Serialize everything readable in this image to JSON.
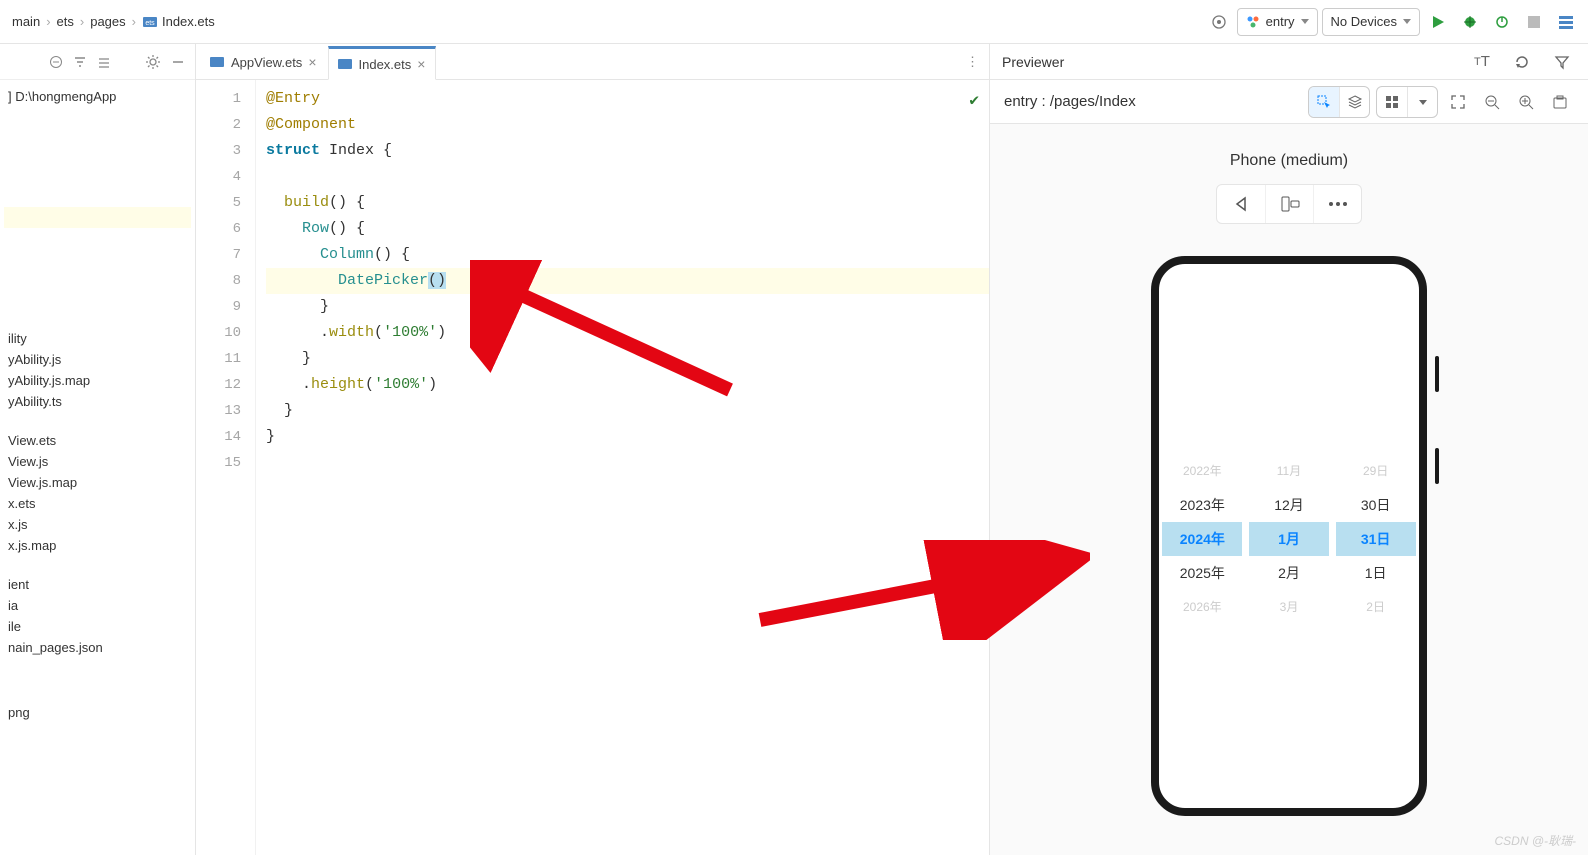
{
  "breadcrumb": [
    "main",
    "ets",
    "pages",
    "Index.ets"
  ],
  "toolbar": {
    "module": "entry",
    "device": "No Devices"
  },
  "tabs": [
    {
      "label": "AppView.ets",
      "active": false
    },
    {
      "label": "Index.ets",
      "active": true
    }
  ],
  "tree": {
    "root": "D:\\hongmengApp",
    "items": [
      "ility",
      "yAbility.js",
      "yAbility.js.map",
      "yAbility.ts",
      "",
      "View.ets",
      "View.js",
      "View.js.map",
      "x.ets",
      "x.js",
      "x.js.map",
      "",
      "ient",
      "ia",
      "ile",
      "nain_pages.json",
      "",
      "",
      "png"
    ]
  },
  "editor": {
    "lines_total": 15,
    "code": {
      "l1_ann": "@Entry",
      "l2_ann": "@Component",
      "l3_kw": "struct",
      "l3_name": " Index ",
      "l3_brace": "{",
      "l5_fn": "build",
      "l5_rest": "() {",
      "l6_call": "Row",
      "l6_rest": "() {",
      "l7_call": "Column",
      "l7_rest": "() {",
      "l8_call": "DatePicker",
      "l8_paren": "()",
      "l9": "}",
      "l10_dot": ".",
      "l10_m": "width",
      "l10_p1": "(",
      "l10_str": "'100%'",
      "l10_p2": ")",
      "l11": "}",
      "l12_dot": ".",
      "l12_m": "height",
      "l12_p1": "(",
      "l12_str": "'100%'",
      "l12_p2": ")",
      "l13": "}",
      "l14": "}"
    }
  },
  "previewer": {
    "title": "Previewer",
    "entry_path": "entry : /pages/Index",
    "caption": "Phone (medium)",
    "picker": {
      "years": [
        "2022年",
        "2023年",
        "2024年",
        "2025年",
        "2026年"
      ],
      "months": [
        "11月",
        "12月",
        "1月",
        "2月",
        "3月"
      ],
      "days": [
        "29日",
        "30日",
        "31日",
        "1日",
        "2日"
      ]
    }
  },
  "watermark": "CSDN @-耿瑞-"
}
